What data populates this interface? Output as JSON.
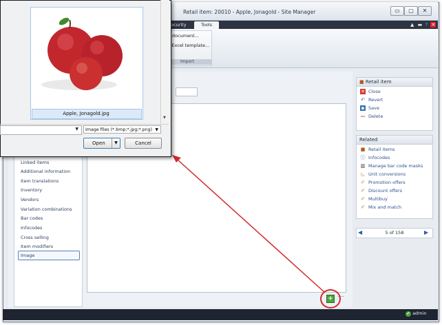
{
  "window": {
    "title": "Retail item: 20010 - Apple, Jonagold - Site Manager"
  },
  "window_controls": {
    "minimize": "▭",
    "maximize": "▢",
    "close": "✕"
  },
  "ribbon": {
    "tabs": [
      {
        "label": "ecurity"
      },
      {
        "label": "Tools"
      }
    ],
    "menu_items": [
      "al document...",
      "w Excel template..."
    ],
    "group_label": "Import"
  },
  "left_nav": {
    "items": [
      "Linked items",
      "Additional information",
      "Item translations",
      "Inventory",
      "Vendors",
      "Variation combinations",
      "Bar codes",
      "Infocodes",
      "Cross selling",
      "Item modifiers",
      "Image"
    ],
    "selected": "Image"
  },
  "retail_panel": {
    "header": "Retail item",
    "actions": [
      {
        "label": "Close",
        "icon": "close-icon",
        "color": "#d4382c"
      },
      {
        "label": "Revert",
        "icon": "revert-icon",
        "color": "#2a5db0"
      },
      {
        "label": "Save",
        "icon": "save-icon",
        "color": "#3a6fb5"
      },
      {
        "label": "Delete",
        "icon": "delete-icon",
        "color": "#d9342b"
      }
    ]
  },
  "related_panel": {
    "header": "Related",
    "links": [
      "Retail items",
      "Infocodes",
      "Manage bar code masks",
      "Unit conversions",
      "Promotion offers",
      "Discount offers",
      "Multibuy",
      "Mix and match"
    ]
  },
  "record_nav": {
    "position": "5 of 158"
  },
  "status_bar": {
    "user": "admin"
  },
  "file_dialog": {
    "file_name": "Apple, Jonagold.jpg",
    "file_type": "Image files (*.bmp;*.jpg;*.png)",
    "open_label": "Open",
    "cancel_label": "Cancel"
  },
  "accent": {
    "highlight": "#d02a2a",
    "add": "#4fa33c"
  }
}
